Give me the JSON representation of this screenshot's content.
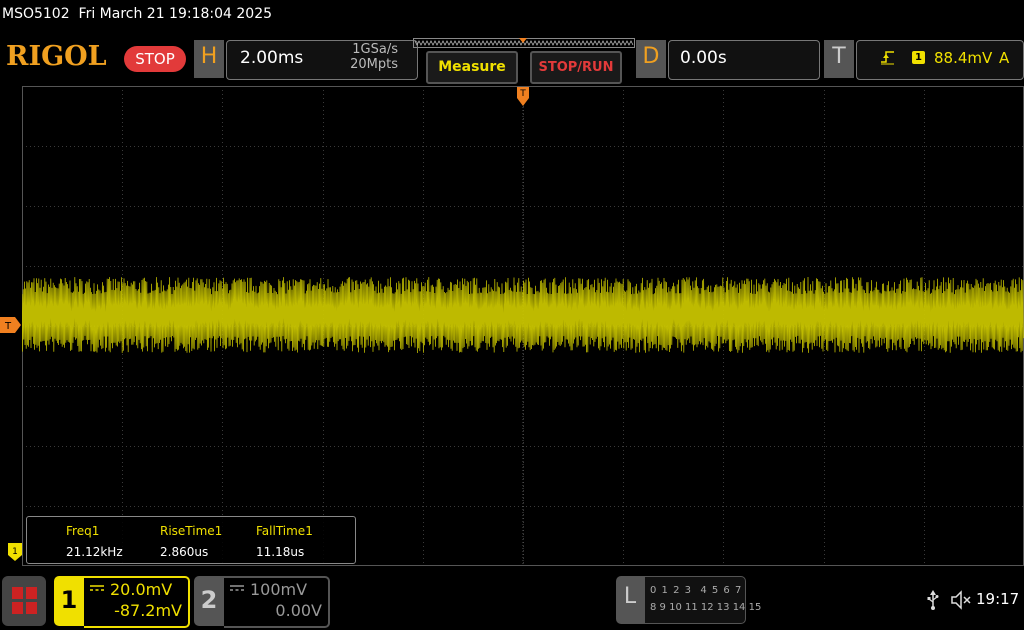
{
  "header": {
    "model": "MSO5102",
    "datetime": "Fri March 21 19:18:04 2025",
    "logo": "RIGOL",
    "run_state": "STOP"
  },
  "horizontal": {
    "label": "H",
    "timebase": "2.00ms",
    "sample_rate": "1GSa/s",
    "memory_depth": "20Mpts"
  },
  "buttons": {
    "measure": "Measure",
    "stop_run": "STOP/RUN"
  },
  "delay": {
    "label": "D",
    "value": "0.00s"
  },
  "trigger": {
    "label": "T",
    "edge_icon": "rising-edge-icon",
    "source": "1",
    "level": "88.4mV",
    "mode": "A"
  },
  "markers": {
    "trigger_level": "T",
    "channel1": "1"
  },
  "measurements": {
    "headers": [
      "Freq1",
      "RiseTime1",
      "FallTime1"
    ],
    "values": [
      "21.12kHz",
      "2.860us",
      "11.18us"
    ]
  },
  "channel1": {
    "number": "1",
    "scale": "20.0mV",
    "offset": "-87.2mV",
    "color": "#f0e000"
  },
  "channel2": {
    "number": "2",
    "scale": "100mV",
    "offset": "0.00V",
    "color": "#999999"
  },
  "logic": {
    "label": "L",
    "row1": "0 1 2 3  4 5 6 7",
    "row2": "8 9 10 11 12 13 14 15"
  },
  "status": {
    "time": "19:17",
    "usb_icon": "usb-icon",
    "mute_icon": "speaker-muted-icon"
  },
  "colors": {
    "accent": "#f0a020",
    "trace": "#d8d400",
    "stop": "#e23a3a"
  }
}
